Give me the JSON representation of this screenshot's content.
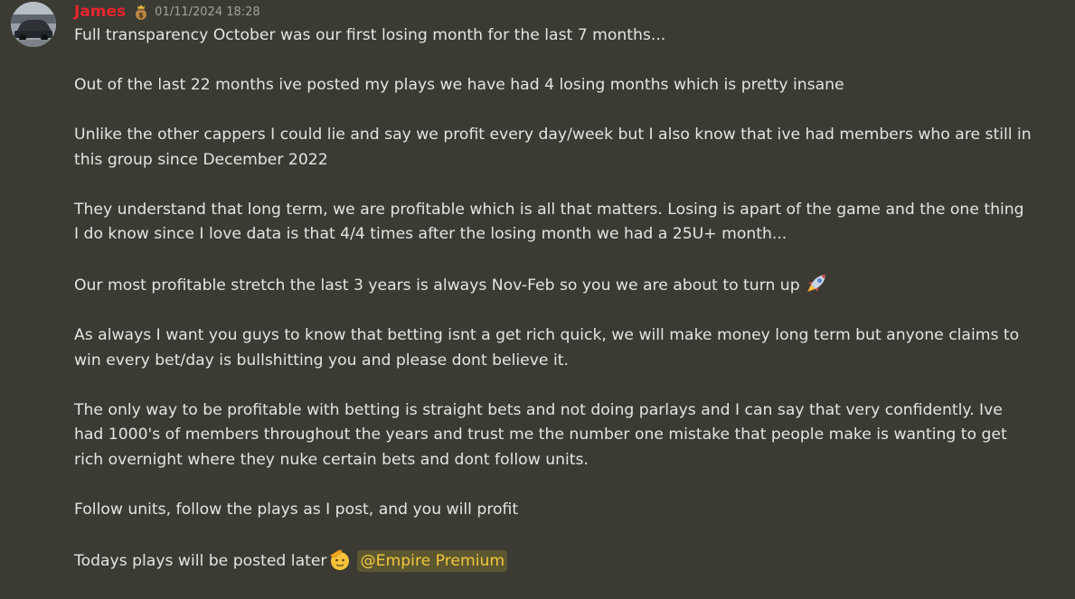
{
  "message": {
    "author": "James",
    "timestamp": "01/11/2024 18:28",
    "role_icon": "crown-money-bag-icon",
    "paragraphs": [
      "Full transparency October was our first losing month for the last 7 months...",
      "Out of the last 22 months ive posted my plays we have had 4 losing months which is pretty insane",
      "Unlike the other cappers I could lie and say we profit every day/week but I also know that ive had members who are still in this group since December 2022",
      "They understand that long term, we are profitable which is all that matters. Losing is apart of the game and the one thing I do know since I love data is that 4/4 times after the losing month we had a 25U+ month...",
      "Our most profitable stretch the last 3 years is always Nov-Feb so you we are about to turn up",
      "As always I want you guys to know that betting isnt a get rich quick, we will make money long term but anyone claims to win every bet/day is bullshitting you and please dont believe it.",
      "The only way to be profitable with betting is straight bets and not doing parlays and I can say that very confidently. Ive had 1000's of members throughout the years and trust me the number one mistake that people make is wanting to get rich overnight where they nuke certain bets and dont follow units.",
      "Follow units, follow the plays as I post, and you will profit",
      "Todays plays will be posted later"
    ],
    "emojis": {
      "rocket": "rocket-emoji",
      "salute": "saluting-face-emoji"
    },
    "mention": "@Empire Premium"
  },
  "colors": {
    "background": "#3b3a33",
    "username": "#e8242c",
    "mention_bg": "#5c5631",
    "mention_text": "#f0c83c"
  }
}
